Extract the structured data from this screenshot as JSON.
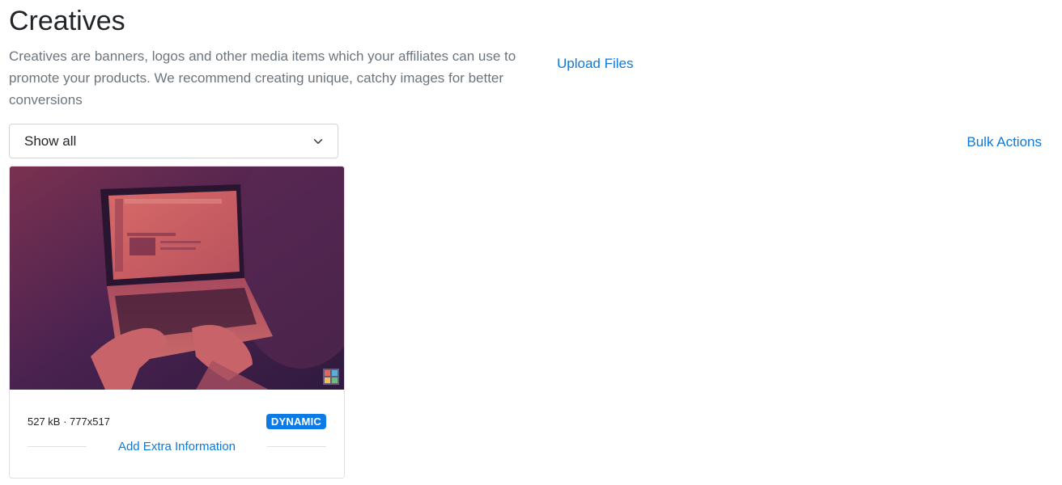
{
  "page": {
    "title": "Creatives",
    "description": "Creatives are banners, logos and other media items which your affiliates can use to promote your products. We recommend creating unique, catchy images for better conversions",
    "upload_label": "Upload Files"
  },
  "toolbar": {
    "filter_value": "Show all",
    "bulk_actions_label": "Bulk Actions"
  },
  "creatives": [
    {
      "file_meta": "527 kB · 777x517",
      "type_badge": "DYNAMIC",
      "extra_info_label": "Add Extra Information"
    }
  ],
  "colors": {
    "link": "#0d79d9",
    "badge": "#0d7be6",
    "thumb_dark": "#3b1d45",
    "thumb_warm": "#c4565f"
  },
  "icons": {
    "select": "chevron-down-icon",
    "thumb_corner": "puzzle-icon"
  }
}
